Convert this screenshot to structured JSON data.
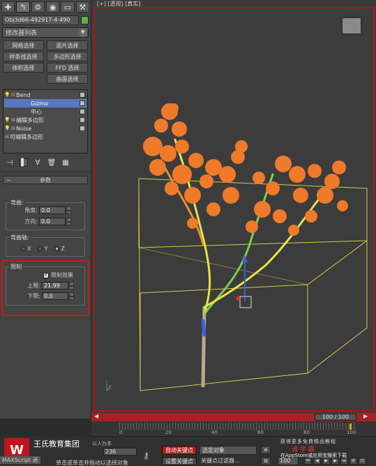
{
  "command_panel": {
    "tabs": [
      "create-tab",
      "modify-tab",
      "hierarchy-tab",
      "motion-tab",
      "display-tab",
      "utilities-tab"
    ],
    "object_name": "Obj3d66-492917-4-490",
    "object_color": "#5fb14a",
    "modifier_list": "修改器列表",
    "buttons": [
      {
        "label": "网格选择"
      },
      {
        "label": "面片选择"
      },
      {
        "label": "样条线选择"
      },
      {
        "label": "多边形选择"
      },
      {
        "label": "体积选择"
      },
      {
        "label": "FFD 选择"
      },
      {
        "label": ""
      },
      {
        "label": "曲面选择"
      }
    ],
    "stack": [
      {
        "label": "Bend",
        "level": 0,
        "selected": false,
        "expanded": true
      },
      {
        "label": "Gizmo",
        "level": 1,
        "selected": true
      },
      {
        "label": "中心",
        "level": 1,
        "selected": false
      },
      {
        "label": "编辑多边形",
        "level": 0,
        "selected": false
      },
      {
        "label": "Noise",
        "level": 0,
        "selected": false
      },
      {
        "label": "可编辑多边形",
        "level": 0,
        "selected": false
      }
    ],
    "rollout_title": "参数",
    "bend": {
      "group_label": "弯曲:",
      "angle_label": "角度:",
      "angle_value": "0.0",
      "direction_label": "方向:",
      "direction_value": "0.0"
    },
    "bend_axis": {
      "group_label": "弯曲轴:",
      "options": [
        "X",
        "Y",
        "Z"
      ],
      "selected": "Z"
    },
    "limits": {
      "group_label": "限制",
      "limit_effect_label": "限制效果",
      "limit_effect_checked": true,
      "upper_label": "上限:",
      "upper_value": "21.99",
      "lower_label": "下限:",
      "lower_value": "0.0"
    }
  },
  "viewport": {
    "label": "[+] [透视] [真实]",
    "border_color": "#b01515",
    "tree_color": "#ee7a2a",
    "gizmo_color": "#e6dc4a"
  },
  "timeline": {
    "slider_value": "100 / 100",
    "ruler_labels": [
      "0",
      "20",
      "40",
      "60",
      "80",
      "100"
    ]
  },
  "status_bar": {
    "logo_glyph": "W",
    "logo_text": "王氏教育集团",
    "logo_slogan": "以人为本",
    "maxscript_label": "MAXScript 迷",
    "prompt": "单击或单击并拖动以选择对象",
    "coord_value": "236",
    "auto_key": "自动关键点",
    "selection_set": "选定对象",
    "set_key": "设置关键点",
    "key_filters": "关键点过滤器...",
    "frame_value": "100",
    "watermark_top": "获得更多免费精品教程",
    "watermark_mid": "请 学 霸",
    "watermark_bot": "在AppStore或应用宝搜索下载"
  }
}
